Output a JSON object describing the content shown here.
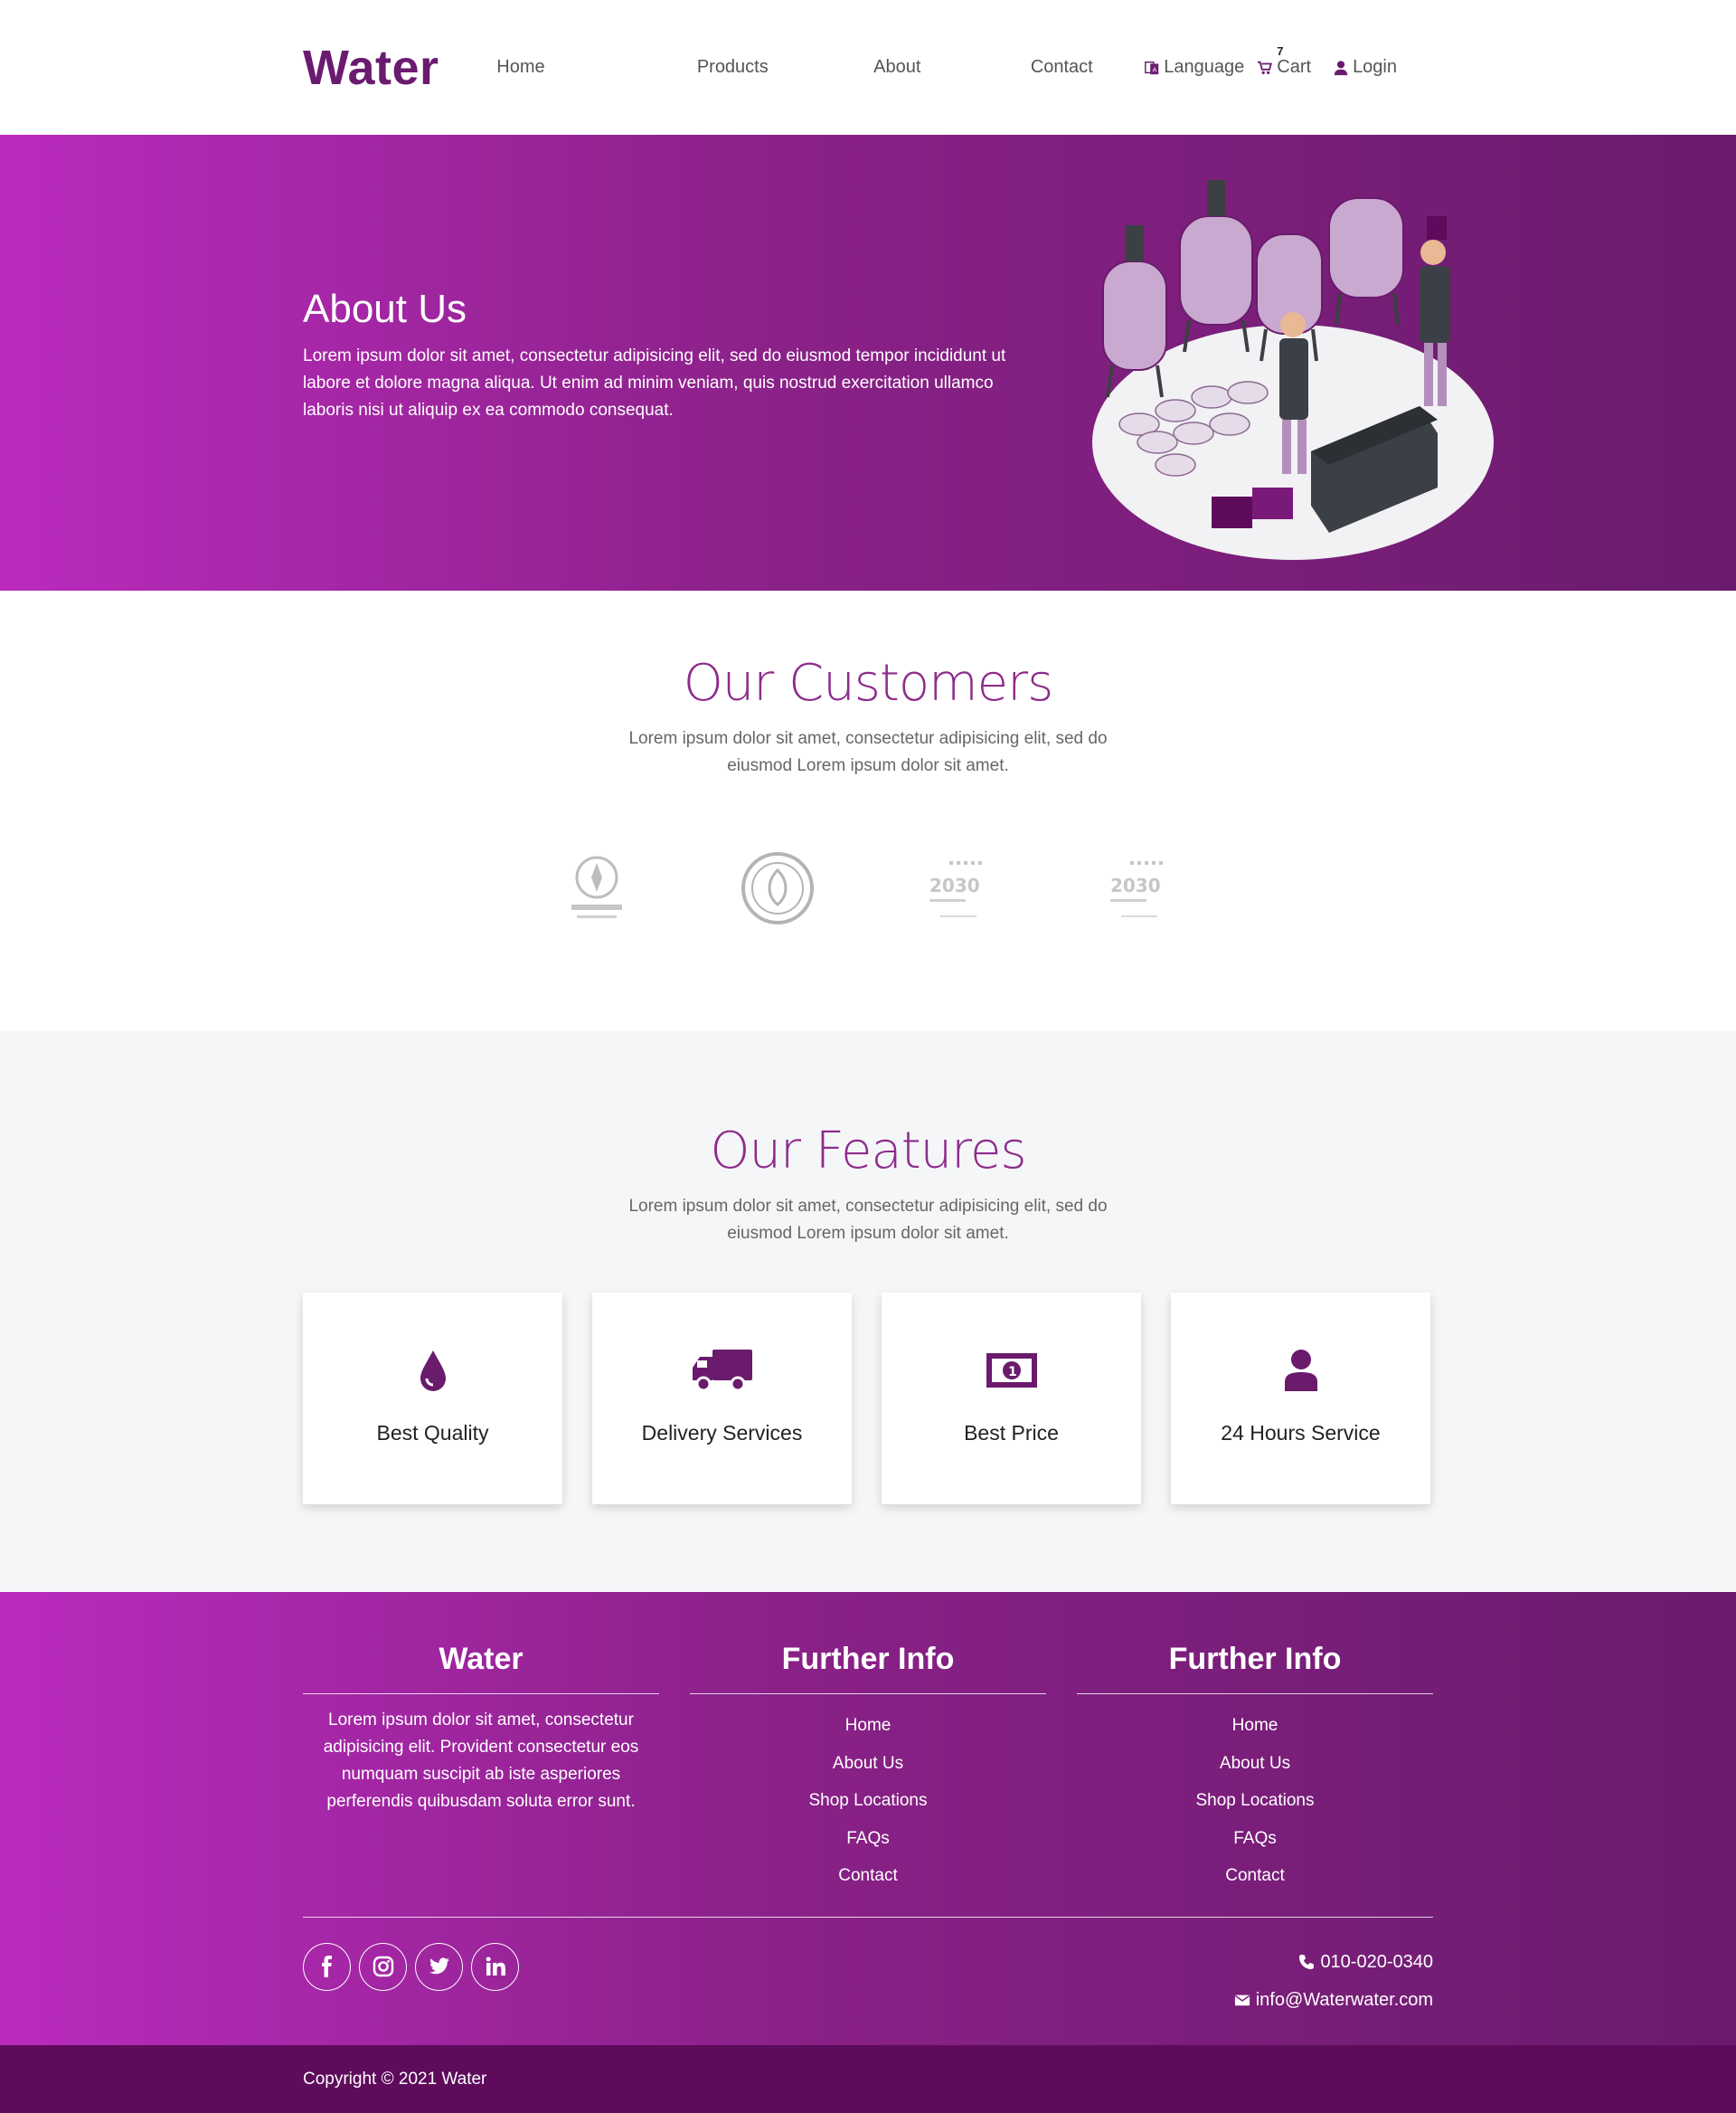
{
  "nav": {
    "brand": "Water",
    "links": [
      "Home",
      "Products",
      "About",
      "Contact"
    ],
    "language": "Language",
    "cart": "Cart",
    "cart_count": "7",
    "login": "Login"
  },
  "hero": {
    "title": "About Us",
    "text": "Lorem ipsum dolor sit amet, consectetur adipisicing elit, sed do eiusmod tempor incididunt ut labore et dolore magna aliqua. Ut enim ad minim veniam, quis nostrud exercitation ullamco laboris nisi ut aliquip ex ea commodo consequat."
  },
  "customers": {
    "title": "Our Customers",
    "subtitle": "Lorem ipsum dolor sit amet, consectetur adipisicing elit, sed do eiusmod Lorem ipsum dolor sit amet.",
    "logos": [
      "ministry-of-defense-logo",
      "round-seal-logo",
      "vision-2030-logo",
      "vision-2030-logo"
    ]
  },
  "features": {
    "title": "Our Features",
    "subtitle": "Lorem ipsum dolor sit amet, consectetur adipisicing elit, sed do eiusmod Lorem ipsum dolor sit amet.",
    "items": [
      {
        "label": "Best Quality",
        "icon": "droplet-icon"
      },
      {
        "label": "Delivery Services",
        "icon": "truck-icon"
      },
      {
        "label": "Best Price",
        "icon": "money-bill-icon"
      },
      {
        "label": "24 Hours Service",
        "icon": "user-icon"
      }
    ]
  },
  "footer": {
    "about_title": "Water",
    "about_text": "Lorem ipsum dolor sit amet, consectetur adipisicing elit. Provident consectetur eos numquam suscipit ab iste asperiores perferendis quibusdam soluta error sunt.",
    "col2_title": "Further Info",
    "col2_links": [
      "Home",
      "About Us",
      "Shop Locations",
      "FAQs",
      "Contact"
    ],
    "col3_title": "Further Info",
    "col3_links": [
      "Home",
      "About Us",
      "Shop Locations",
      "FAQs",
      "Contact"
    ],
    "phone": "010-020-0340",
    "email": "info@Waterwater.com",
    "socials": [
      "facebook-icon",
      "instagram-icon",
      "twitter-icon",
      "linkedin-icon"
    ]
  },
  "copyright": "Copyright © 2021 Water",
  "colors": {
    "brand": "#6a1b6f",
    "gradient_start": "#ba2bbd",
    "gradient_end": "#6a1b6c",
    "copyright_bg": "#5e0b5c"
  }
}
